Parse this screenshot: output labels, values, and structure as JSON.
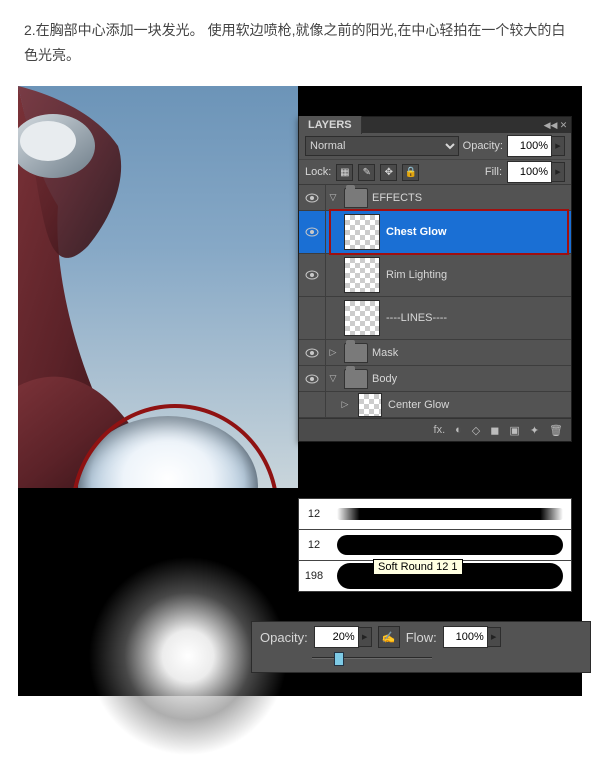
{
  "instruction": "2.在胸部中心添加一块发光。 使用软边喷枪,就像之前的阳光,在中心轻拍在一个较大的白色光亮。",
  "panel": {
    "title": "LAYERS",
    "blend_mode": "Normal",
    "opacity_label": "Opacity:",
    "opacity_value": "100%",
    "lock_label": "Lock:",
    "fill_label": "Fill:",
    "fill_value": "100%"
  },
  "layers": {
    "effects_group": "EFFECTS",
    "chest_glow": "Chest Glow",
    "rim_lighting": "Rim Lighting",
    "lines": "----LINES----",
    "mask": "Mask",
    "body_group": "Body",
    "center_glow": "Center Glow"
  },
  "footer_icons": [
    "fx.",
    "◐",
    "◇",
    "◼",
    "▣",
    "✦",
    "🗑"
  ],
  "brushes": {
    "size1": "12",
    "size2": "12",
    "size3": "198",
    "tooltip": "Soft Round 12 1"
  },
  "options": {
    "opacity_label": "Opacity:",
    "opacity_value": "20%",
    "flow_label": "Flow:",
    "flow_value": "100%"
  }
}
